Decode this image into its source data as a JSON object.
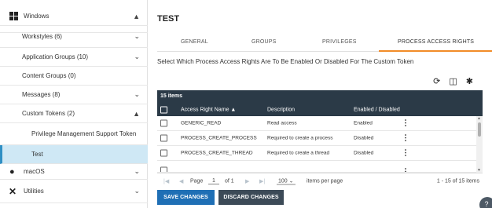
{
  "sidebar": {
    "items": [
      {
        "label": "Windows",
        "chevron": "▲"
      },
      {
        "label": "Workstyles (6)",
        "chevron": "⌄"
      },
      {
        "label": "Application Groups (10)",
        "chevron": "⌄"
      },
      {
        "label": "Content Groups (0)",
        "chevron": ""
      },
      {
        "label": "Messages (8)",
        "chevron": "⌄"
      },
      {
        "label": "Custom Tokens (2)",
        "chevron": "▲"
      },
      {
        "label": "Privilege Management Support Token",
        "chevron": ""
      },
      {
        "label": "Test",
        "chevron": ""
      },
      {
        "label": "macOS",
        "chevron": "⌄"
      },
      {
        "label": "Utilities",
        "chevron": "⌄"
      }
    ]
  },
  "main": {
    "title": "TEST",
    "tabs": [
      {
        "label": "GENERAL"
      },
      {
        "label": "GROUPS"
      },
      {
        "label": "PRIVILEGES"
      },
      {
        "label": "PROCESS ACCESS RIGHTS"
      }
    ],
    "active_tab": "PROCESS ACCESS RIGHTS",
    "instruction": "Select Which Process Access Rights Are To Be Enabled Or Disabled For The Custom Token"
  },
  "table": {
    "items_count": "15 items",
    "columns": [
      "Access Right Name ▲",
      "Description",
      "Enabled / Disabled"
    ],
    "rows": [
      {
        "name": "GENERIC_READ",
        "description": "Read access",
        "status": "Enabled"
      },
      {
        "name": "PROCESS_CREATE_PROCESS",
        "description": "Required to create a process",
        "status": "Disabled"
      },
      {
        "name": "PROCESS_CREATE_THREAD",
        "description": "Required to create a thread",
        "status": "Disabled"
      }
    ]
  },
  "pager": {
    "page_label": "Page",
    "page_value": "1",
    "of_label": "of 1",
    "per_page_value": "100",
    "per_page_label": "items per page",
    "range": "1 - 15 of 15 items"
  },
  "buttons": {
    "save": "SAVE CHANGES",
    "discard": "DISCARD CHANGES"
  },
  "help": {
    "label": "?"
  },
  "colors": {
    "accent_orange": "#f28c28",
    "header_dark": "#2b3a47",
    "save_blue": "#1f6fb5",
    "selected_bg": "#cfe8f5"
  }
}
